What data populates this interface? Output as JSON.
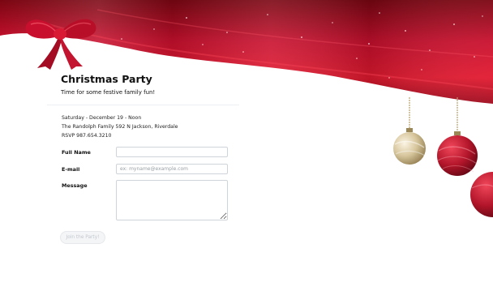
{
  "event": {
    "title": "Christmas Party",
    "subtitle": "Time for some festive family fun!",
    "date_line": "Saturday - December 19 - Noon",
    "address_line": "The Randolph Family 592 N Jackson, Riverdale",
    "rsvp_line": "RSVP 987.654.3210"
  },
  "form": {
    "full_name_label": "Full Name",
    "full_name_value": "",
    "email_label": "E-mail",
    "email_placeholder": "ex: myname@example.com",
    "message_label": "Message",
    "message_value": "",
    "submit_label": "Join the Party!"
  },
  "theme": {
    "banner_red": "#c8102e",
    "ornament_gold": "#d8c79e",
    "ornament_red": "#b3152a"
  },
  "decorations": [
    "ribbon-bow-icon",
    "ornament-icon"
  ]
}
